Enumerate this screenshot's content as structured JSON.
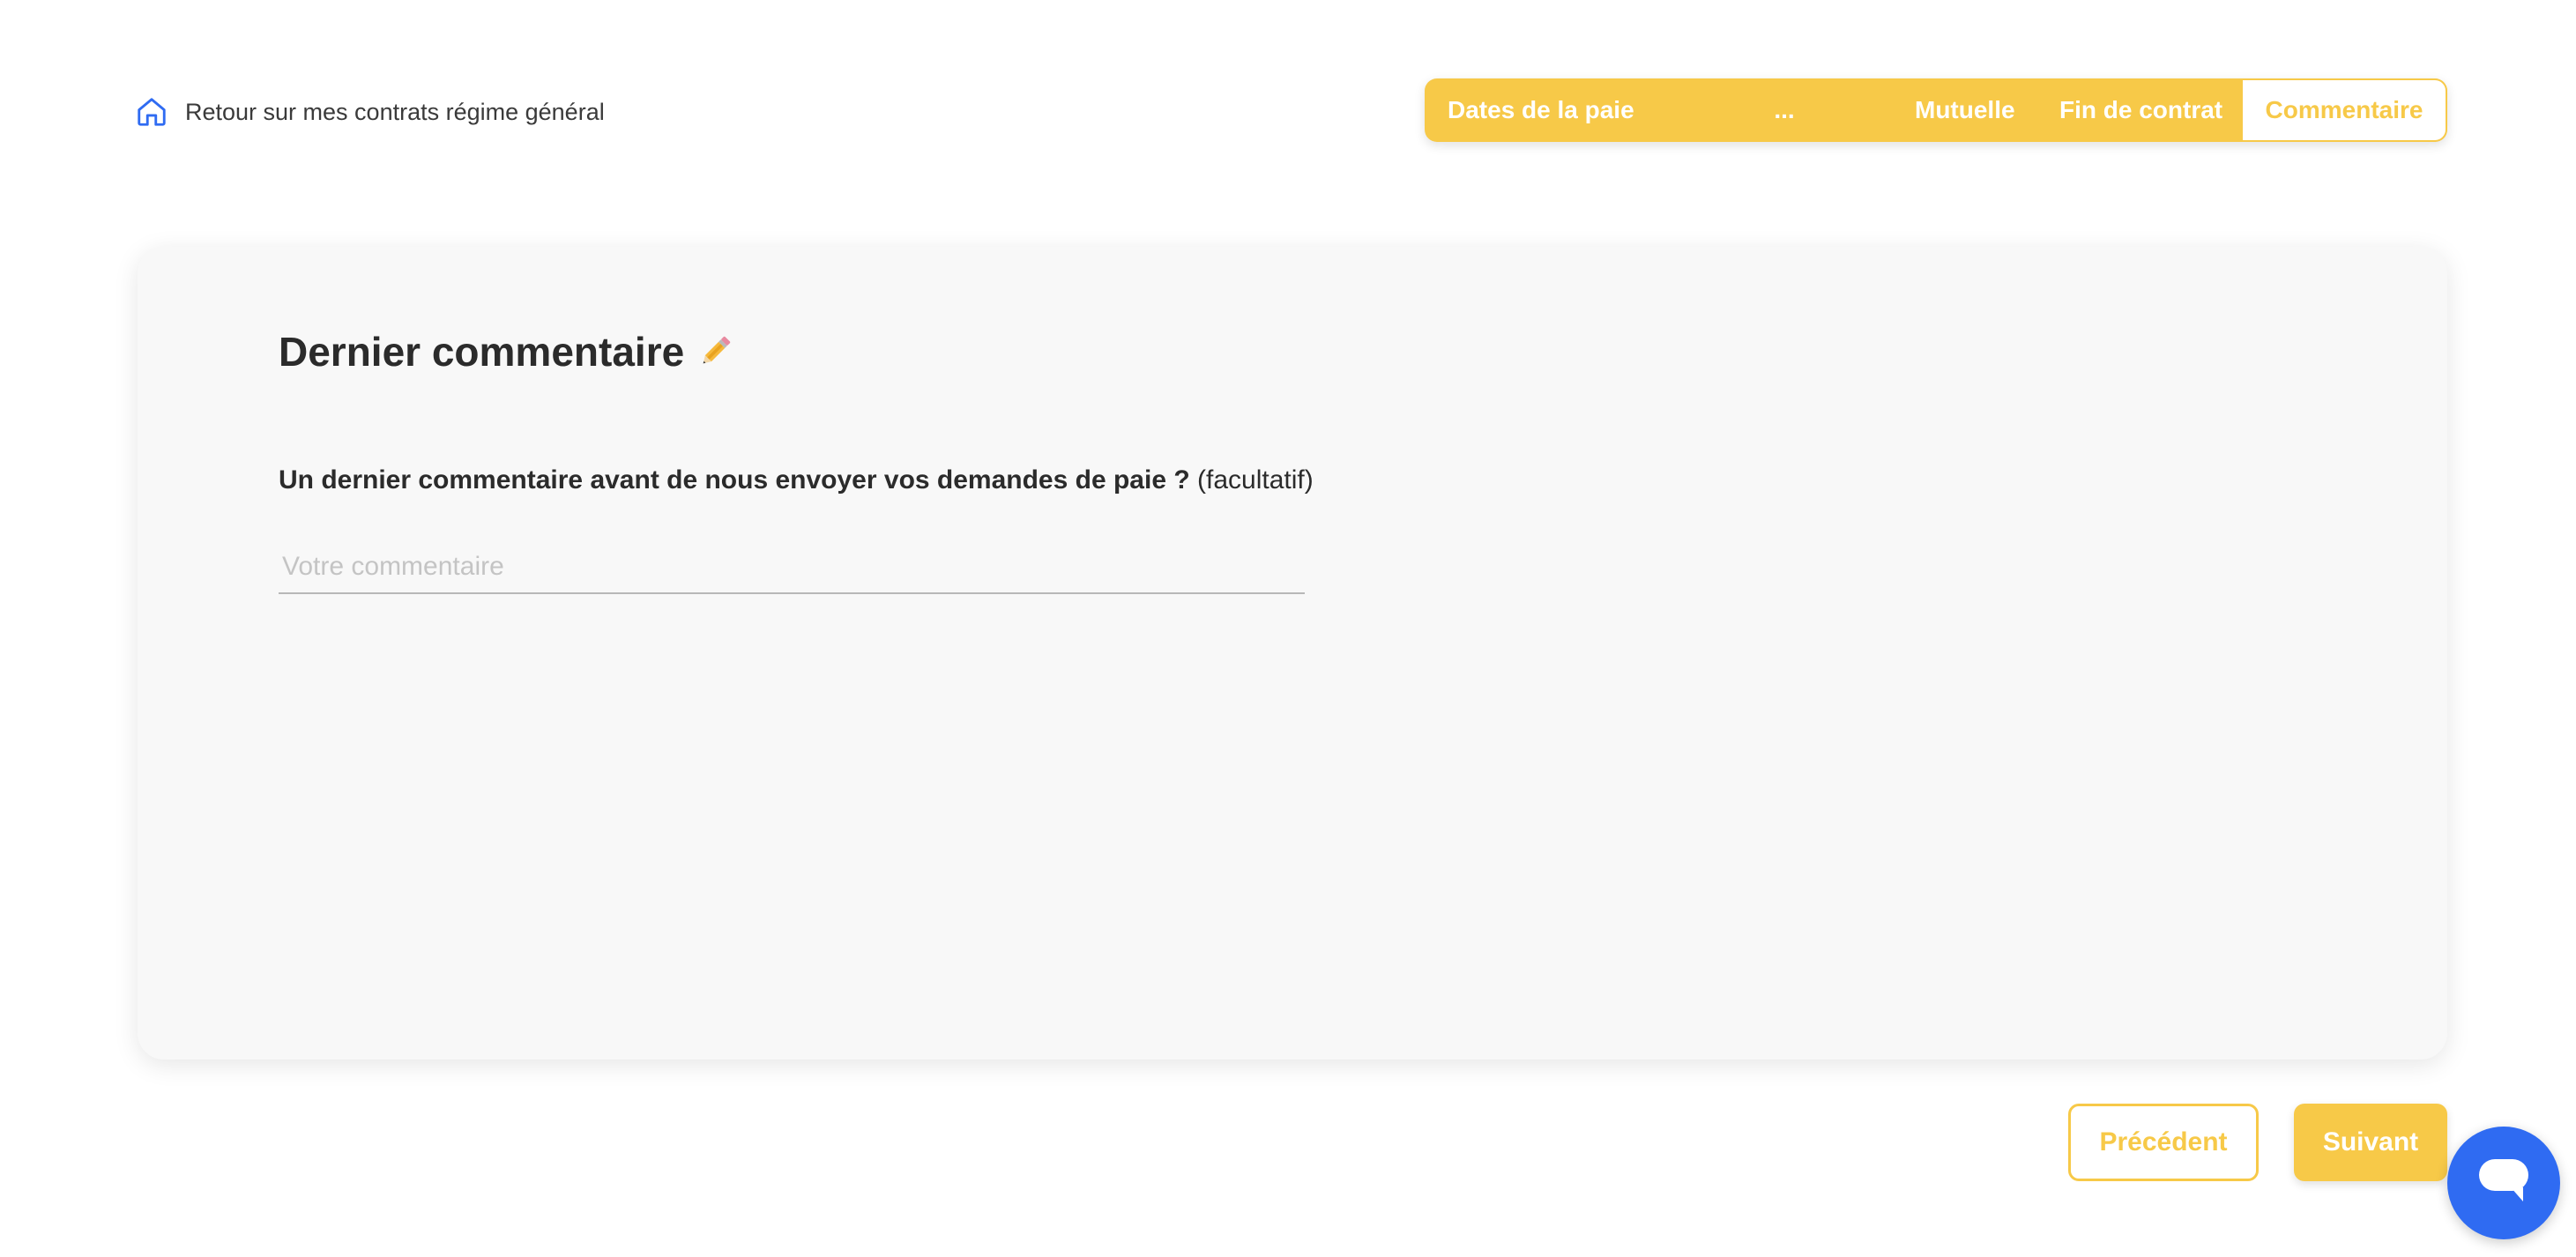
{
  "back_link": {
    "label": "Retour sur mes contrats régime général",
    "icon": "home-icon"
  },
  "stepper": {
    "steps": [
      {
        "label": "Dates de la paie"
      },
      {
        "label": "..."
      },
      {
        "label": "Mutuelle"
      },
      {
        "label": "Fin de contrat"
      },
      {
        "label": "Commentaire"
      }
    ],
    "active_index": 4
  },
  "card": {
    "title": "Dernier commentaire",
    "title_icon": "pencil-icon",
    "question": "Un dernier commentaire avant de nous envoyer vos demandes de paie ?",
    "question_optional": "(facultatif)",
    "comment_input": {
      "placeholder": "Votre commentaire",
      "value": ""
    }
  },
  "navigation": {
    "previous_label": "Précédent",
    "next_label": "Suivant"
  },
  "chat": {
    "icon": "chat-bubble-icon"
  },
  "colors": {
    "accent": "#f7c948",
    "chat": "#2f6bf2",
    "card_bg": "#f8f8f8",
    "text": "#2b2b2b"
  }
}
